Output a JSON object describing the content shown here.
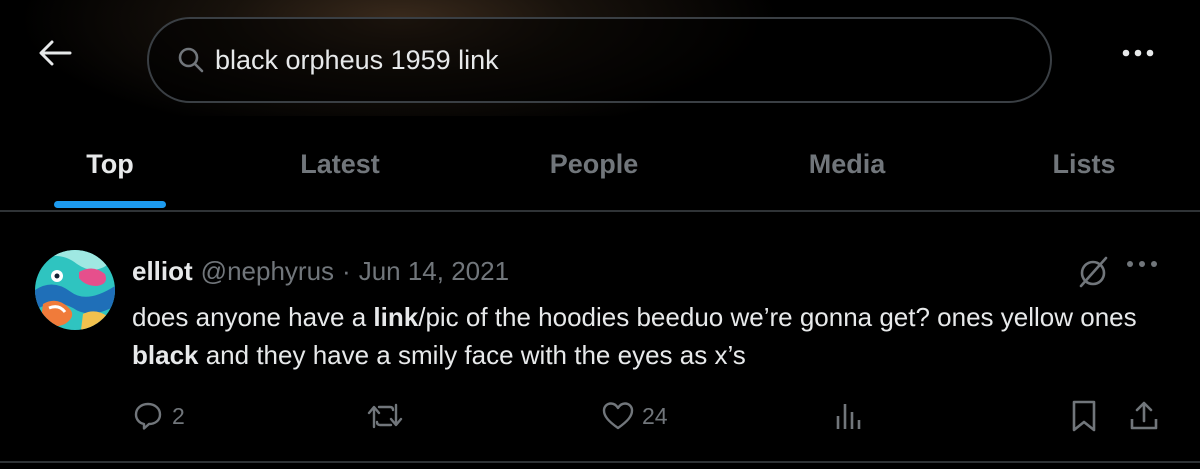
{
  "header": {
    "search_value": "black orpheus 1959 link"
  },
  "tabs": [
    {
      "label": "Top",
      "active": true
    },
    {
      "label": "Latest",
      "active": false
    },
    {
      "label": "People",
      "active": false
    },
    {
      "label": "Media",
      "active": false
    },
    {
      "label": "Lists",
      "active": false
    }
  ],
  "tweet": {
    "display_name": "elliot",
    "handle": "@nephyrus",
    "separator": "·",
    "date": "Jun 14, 2021",
    "text_parts": [
      {
        "t": "does anyone have a ",
        "bold": false
      },
      {
        "t": "link",
        "bold": true
      },
      {
        "t": "/pic of the hoodies beeduo we’re gonna get? ones yellow ones ",
        "bold": false
      },
      {
        "t": "black",
        "bold": true
      },
      {
        "t": " and they have a smily face with the eyes as x’s",
        "bold": false
      }
    ],
    "replies": "2",
    "likes": "24"
  },
  "colors": {
    "accent": "#1d9bf0",
    "muted": "#71767b",
    "text": "#e7e9ea",
    "background": "#000000",
    "border": "#2f3336"
  },
  "icons": [
    "back-arrow-icon",
    "search-icon",
    "more-icon",
    "grok-icon",
    "reply-icon",
    "retweet-icon",
    "like-icon",
    "views-icon",
    "bookmark-icon",
    "share-icon"
  ]
}
